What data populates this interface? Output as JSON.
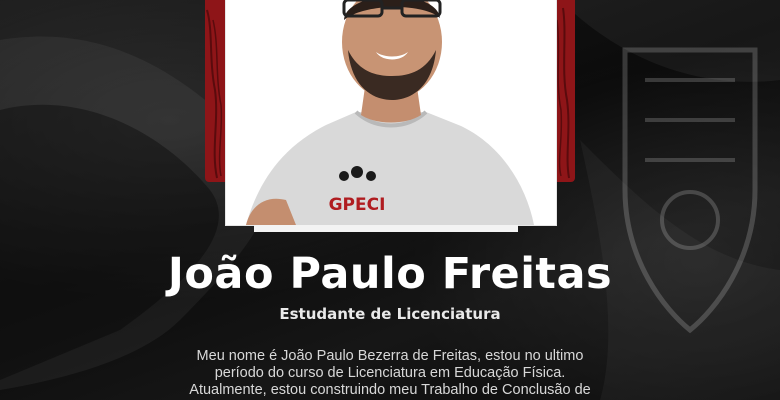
{
  "profile": {
    "name": "João Paulo Freitas",
    "role": "Estudante de Licenciatura",
    "shirt_logo_text": "GPECI",
    "bio_lines": [
      "Meu nome é João Paulo Bezerra de Freitas, estou no ultimo",
      "período do curso de Licenciatura em Educação Física.",
      "Atualmente, estou construindo meu Trabalho de Conclusão de"
    ]
  },
  "colors": {
    "accent_red": "#8e1518",
    "background": "#0d0d0d",
    "text": "#ffffff"
  },
  "icons": {
    "photo": "portrait-photo",
    "crest": "background-crest"
  }
}
